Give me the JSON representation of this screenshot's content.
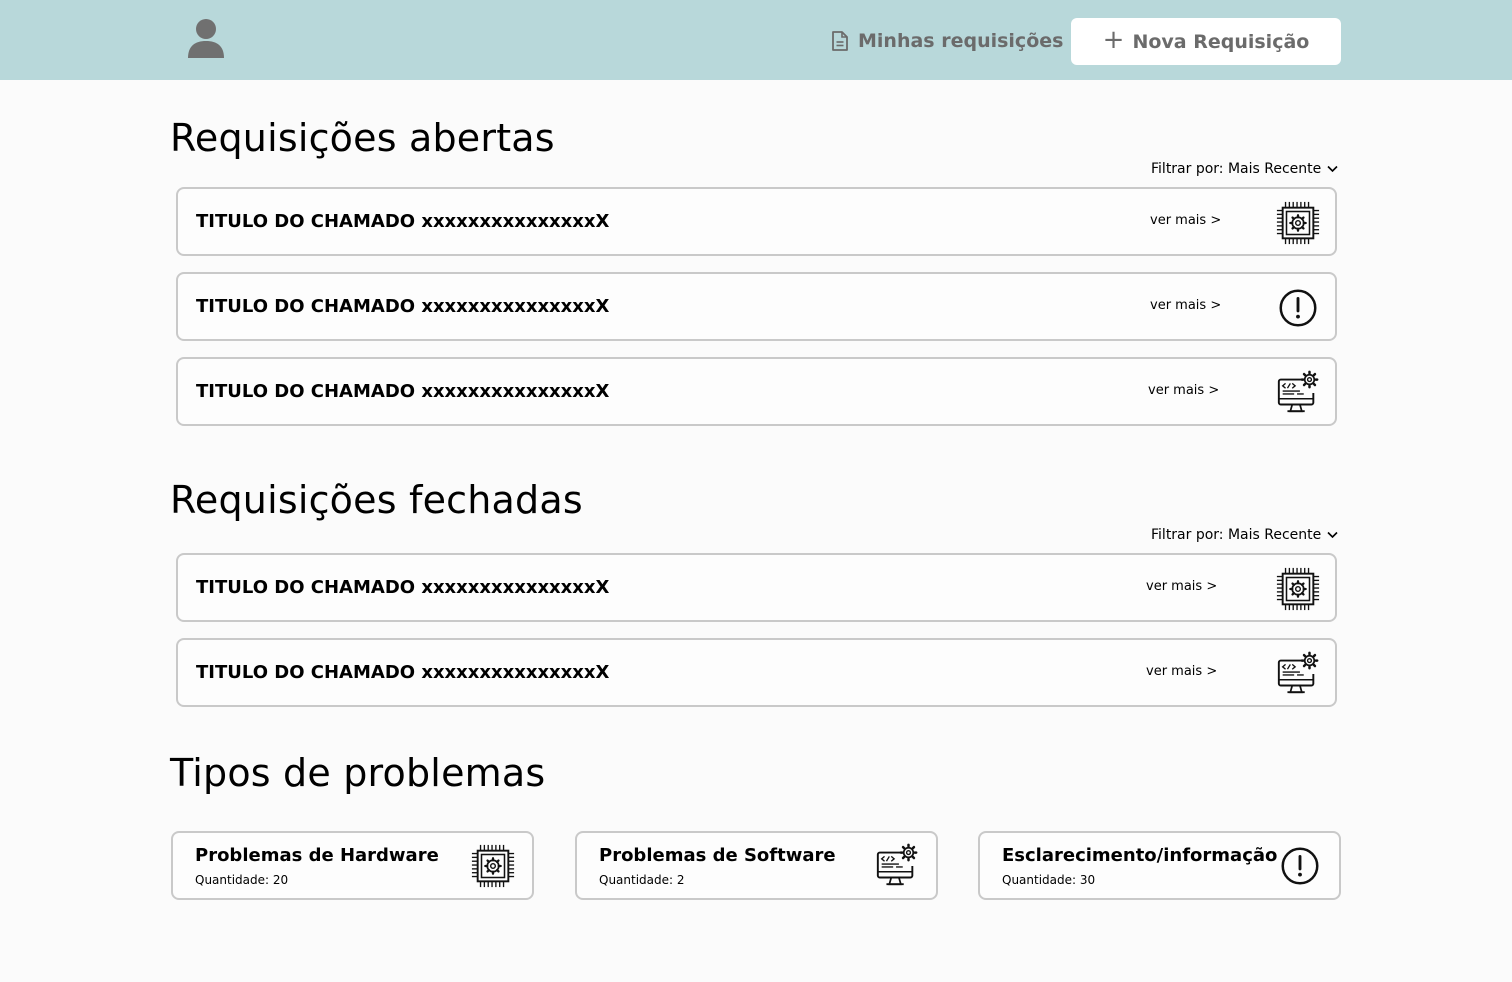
{
  "header": {
    "avatar_icon": "user-icon",
    "my_requests_label": "Minhas requisições",
    "my_requests_icon": "document-icon",
    "new_request_label": "Nova Requisição",
    "new_request_icon": "plus-icon",
    "background": "#b8d8da"
  },
  "open_section": {
    "title": "Requisições abertas",
    "filter_label": "Filtrar por: Mais Recente",
    "tickets": [
      {
        "title": "TITULO DO CHAMADO xxxxxxxxxxxxxxxX",
        "more": "ver mais >",
        "icon": "chip-icon"
      },
      {
        "title": "TITULO DO CHAMADO xxxxxxxxxxxxxxxX",
        "more": "ver mais >",
        "icon": "alert-icon"
      },
      {
        "title": "TITULO DO CHAMADO xxxxxxxxxxxxxxxX",
        "more": "ver mais >",
        "icon": "software-icon"
      }
    ]
  },
  "closed_section": {
    "title": "Requisições fechadas",
    "filter_label": "Filtrar por: Mais Recente",
    "tickets": [
      {
        "title": "TITULO DO CHAMADO xxxxxxxxxxxxxxxX",
        "more": "ver mais >",
        "icon": "chip-icon"
      },
      {
        "title": "TITULO DO CHAMADO xxxxxxxxxxxxxxxX",
        "more": "ver mais >",
        "icon": "software-icon"
      }
    ]
  },
  "types_section": {
    "title": "Tipos de problemas",
    "cards": [
      {
        "title": "Problemas de Hardware",
        "count": "Quantidade: 20",
        "icon": "chip-icon"
      },
      {
        "title": "Problemas de Software",
        "count": "Quantidade: 2",
        "icon": "software-icon"
      },
      {
        "title": "Esclarecimento/informação",
        "count": "Quantidade: 30",
        "icon": "alert-icon"
      }
    ]
  }
}
